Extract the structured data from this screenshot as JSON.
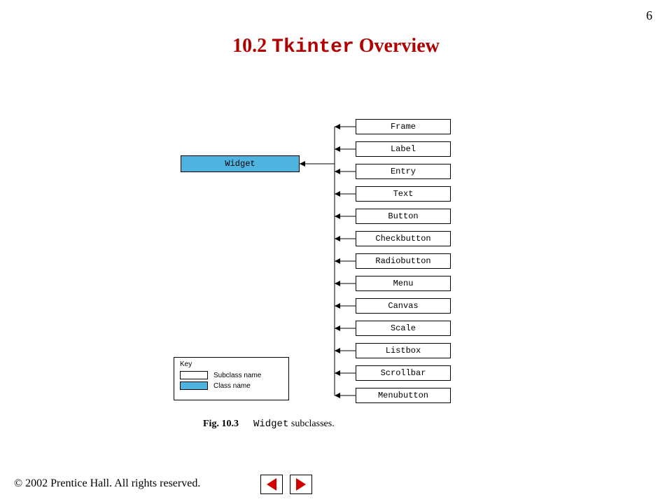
{
  "page_number": "6",
  "title": {
    "section": "10.2",
    "mono": "Tkinter",
    "rest": "Overview"
  },
  "diagram": {
    "class_box": "Widget",
    "subclasses": [
      "Frame",
      "Label",
      "Entry",
      "Text",
      "Button",
      "Checkbutton",
      "Radiobutton",
      "Menu",
      "Canvas",
      "Scale",
      "Listbox",
      "Scrollbar",
      "Menubutton"
    ]
  },
  "key": {
    "title": "Key",
    "subclass_label": "Subclass name",
    "class_label": "Class name"
  },
  "caption": {
    "fig": "Fig. 10.3",
    "mono": "Widget",
    "rest": " subclasses."
  },
  "footer": "© 2002 Prentice Hall. All rights reserved."
}
